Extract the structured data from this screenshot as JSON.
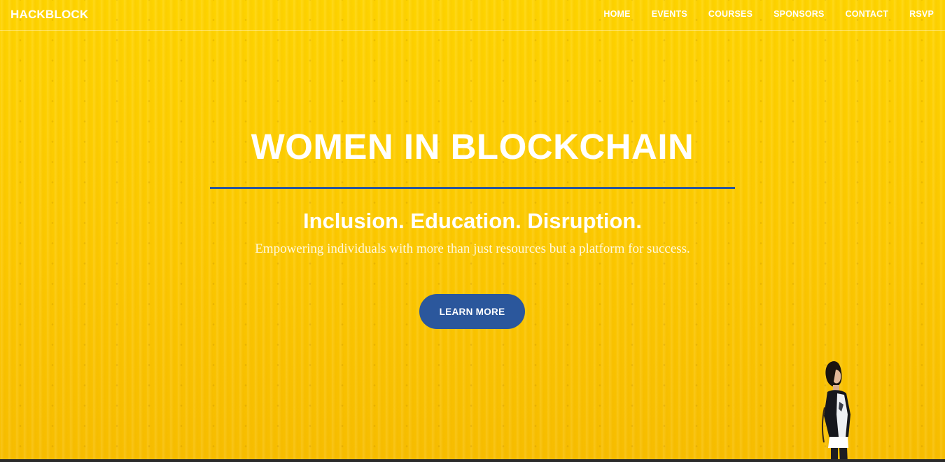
{
  "brand": "HACKBLOCK",
  "nav": {
    "items": [
      {
        "label": "HOME"
      },
      {
        "label": "EVENTS"
      },
      {
        "label": "COURSES"
      },
      {
        "label": "SPONSORS"
      },
      {
        "label": "CONTACT"
      },
      {
        "label": "RSVP"
      }
    ]
  },
  "hero": {
    "title": "WOMEN IN BLOCKCHAIN",
    "tagline": "Inclusion. Education. Disruption.",
    "subtext": "Empowering individuals with more than just resources but a platform for success.",
    "cta_label": "LEARN MORE"
  },
  "colors": {
    "background": "#fbc900",
    "accent": "#2b579c",
    "text": "#ffffff"
  }
}
